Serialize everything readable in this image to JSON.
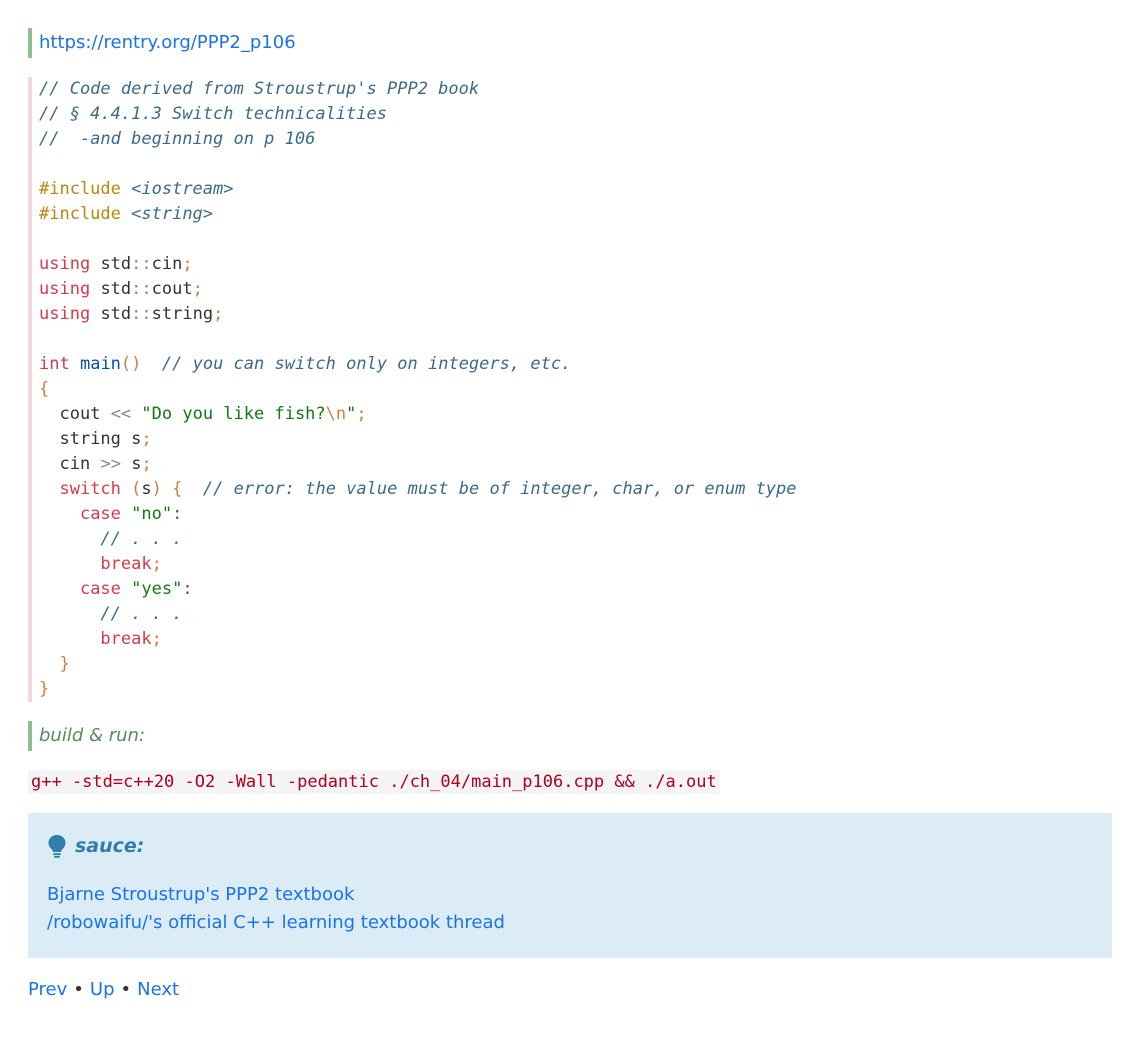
{
  "header_link": "https://rentry.org/PPP2_p106",
  "code": {
    "comment1": "// Code derived from Stroustrup's PPP2 book",
    "comment2": "// § 4.4.1.3 Switch technicalities",
    "comment3": "//  -and beginning on p 106",
    "include_kw": "#include",
    "include1": "<iostream>",
    "include2": "<string>",
    "using_kw": "using",
    "std": "std",
    "scope": "::",
    "cin": "cin",
    "cout": "cout",
    "string": "string",
    "semicolon": ";",
    "int_kw": "int",
    "main_fn": "main",
    "parens": "()",
    "main_comment": "// you can switch only on integers, etc.",
    "open_brace": "{",
    "close_brace": "}",
    "out_op": "<<",
    "in_op": ">>",
    "fish_str_open": "\"Do you like fish?",
    "newline_esc": "\\n",
    "quote": "\"",
    "string_type": "string",
    "var_s": "s",
    "switch_kw": "switch",
    "lparen": "(",
    "rparen": ")",
    "switch_comment": "// error: the value must be of integer, char, or enum type",
    "case_kw": "case",
    "str_no": "\"no\"",
    "str_yes": "\"yes\"",
    "colon": ":",
    "ellipsis_comment": "// . . .",
    "break_kw": "break"
  },
  "build_label": "build & run:",
  "build_command": "g++ -std=c++20 -O2 -Wall -pedantic ./ch_04/main_p106.cpp && ./a.out",
  "sauce": {
    "title": "sauce:",
    "icon": "lightbulb-icon",
    "links": [
      "Bjarne Stroustrup's PPP2 textbook",
      "/robowaifu/'s official C++ learning textbook thread"
    ]
  },
  "nav": {
    "prev": "Prev",
    "up": "Up",
    "next": "Next",
    "separator": "•"
  },
  "colors": {
    "link": "#1a73e8",
    "admonition_bg": "#dbecf6",
    "admonition_title": "#2f7fa8",
    "quote_border": "#8fbf8f",
    "code_border": "#f5d5d5",
    "keyword": "#d73a49",
    "string": "#117a11",
    "comment": "#3b6b8a"
  }
}
